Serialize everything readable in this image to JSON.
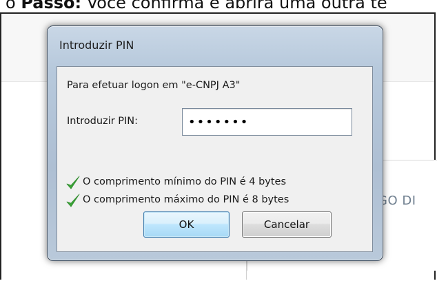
{
  "background": {
    "doc_header_prefix": "o ",
    "doc_header_bold": "Passo:",
    "doc_header_rest": " Você confirma e abrirá uma outra te",
    "panel_text": "GO DI"
  },
  "dialog": {
    "title": "Introduzir PIN",
    "prompt": "Para efetuar logon em \"e-CNPJ A3\"",
    "pin_label": "Introduzir PIN:",
    "pin_value": "•••••••",
    "rules": [
      "O comprimento mínimo do PIN é 4 bytes",
      "O comprimento máximo do PIN é 8 bytes"
    ],
    "ok_label": "OK",
    "cancel_label": "Cancelar"
  },
  "colors": {
    "check_green": "#3aa537",
    "ok_border": "#3d7bad",
    "frame_blue": "#b7c9dc"
  },
  "icons": {
    "rule_icon": "checkmark-icon"
  }
}
